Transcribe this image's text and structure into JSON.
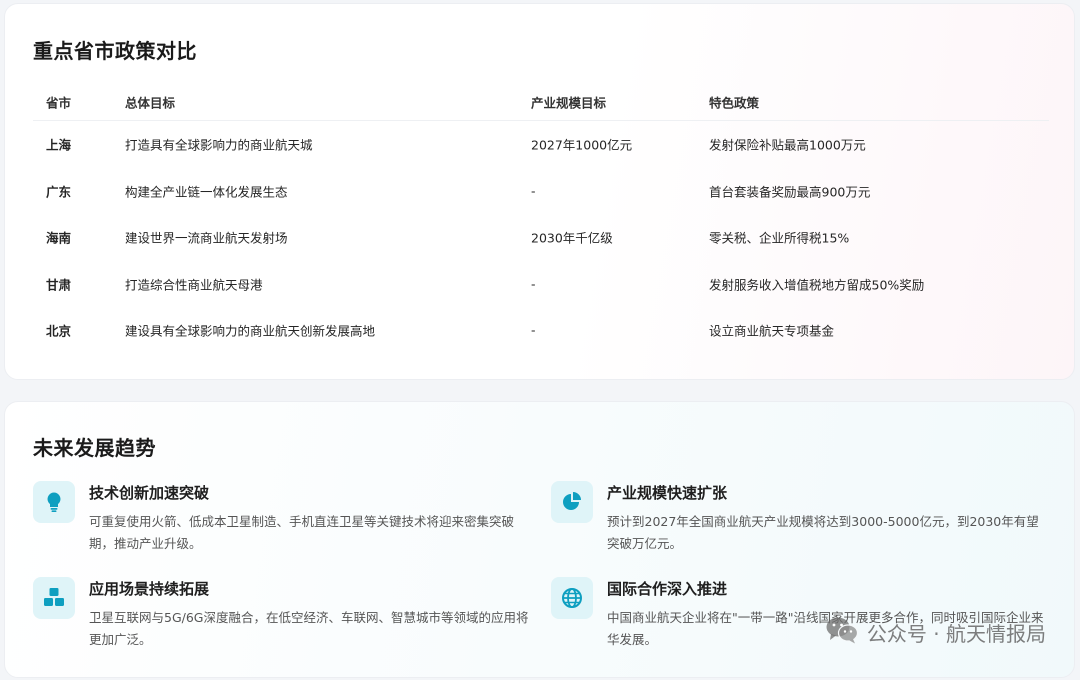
{
  "policy": {
    "title": "重点省市政策对比",
    "headers": [
      "省市",
      "总体目标",
      "产业规模目标",
      "特色政策"
    ],
    "rows": [
      [
        "上海",
        "打造具有全球影响力的商业航天城",
        "2027年1000亿元",
        "发射保险补贴最高1000万元"
      ],
      [
        "广东",
        "构建全产业链一体化发展生态",
        "-",
        "首台套装备奖励最高900万元"
      ],
      [
        "海南",
        "建设世界一流商业航天发射场",
        "2030年千亿级",
        "零关税、企业所得税15%"
      ],
      [
        "甘肃",
        "打造综合性商业航天母港",
        "-",
        "发射服务收入增值税地方留成50%奖励"
      ],
      [
        "北京",
        "建设具有全球影响力的商业航天创新发展高地",
        "-",
        "设立商业航天专项基金"
      ]
    ]
  },
  "trends": {
    "title": "未来发展趋势",
    "accent": "#0e9fc0",
    "items": [
      {
        "icon": "lightbulb-icon",
        "title": "技术创新加速突破",
        "desc": "可重复使用火箭、低成本卫星制造、手机直连卫星等关键技术将迎来密集突破期，推动产业升级。"
      },
      {
        "icon": "pie-chart-icon",
        "title": "产业规模快速扩张",
        "desc": "预计到2027年全国商业航天产业规模将达到3000-5000亿元，到2030年有望突破万亿元。"
      },
      {
        "icon": "cubes-icon",
        "title": "应用场景持续拓展",
        "desc": "卫星互联网与5G/6G深度融合，在低空经济、车联网、智慧城市等领域的应用将更加广泛。"
      },
      {
        "icon": "globe-icon",
        "title": "国际合作深入推进",
        "desc": "中国商业航天企业将在\"一带一路\"沿线国家开展更多合作，同时吸引国际企业来华发展。"
      }
    ]
  },
  "watermark": {
    "text": "公众号 · 航天情报局",
    "icon": "wechat-icon"
  }
}
